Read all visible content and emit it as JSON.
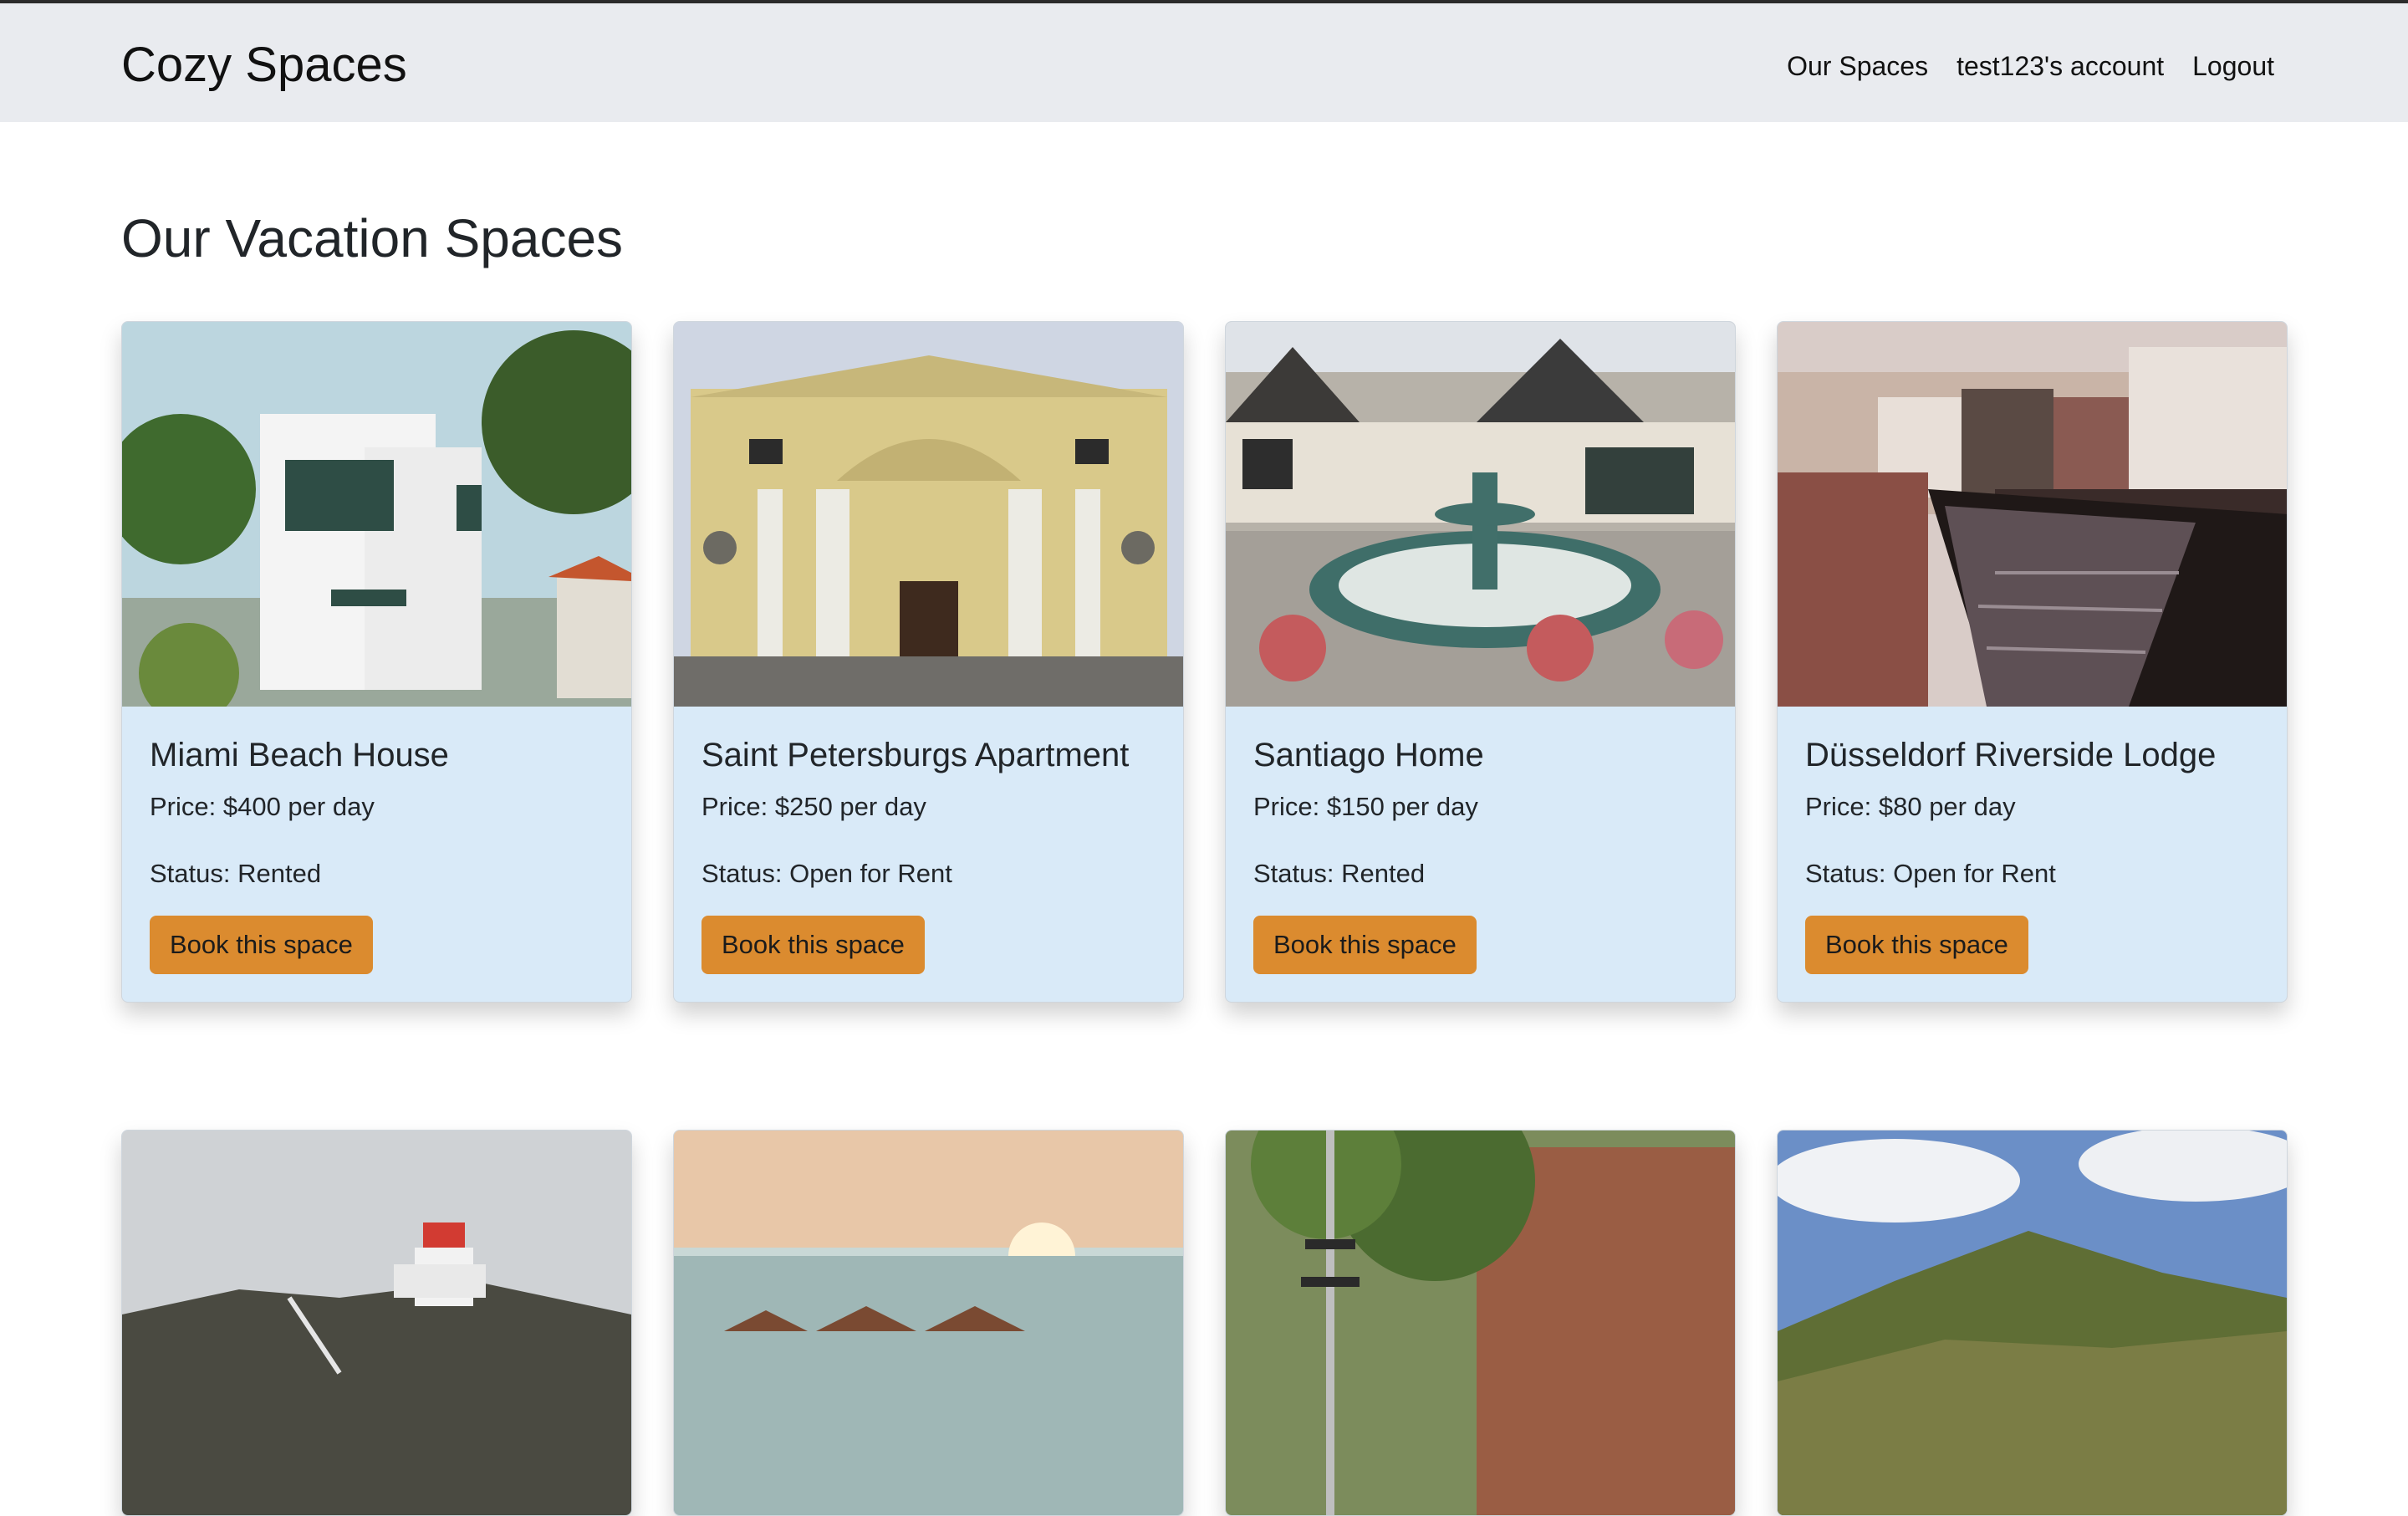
{
  "navbar": {
    "brand": "Cozy Spaces",
    "links": [
      "Our Spaces",
      "test123's account",
      "Logout"
    ]
  },
  "page": {
    "title": "Our Vacation Spaces"
  },
  "spaces": [
    {
      "name": "Miami Beach House",
      "price": "Price: $400 per day",
      "status": "Status: Rented",
      "button": "Book this space",
      "image": "white-modern-house-photo"
    },
    {
      "name": "Saint Petersburgs Apartment",
      "price": "Price: $250 per day",
      "status": "Status: Open for Rent",
      "button": "Book this space",
      "image": "yellow-cathedral-photo"
    },
    {
      "name": "Santiago Home",
      "price": "Price: $150 per day",
      "status": "Status: Rented",
      "button": "Book this space",
      "image": "fountain-courtyard-photo"
    },
    {
      "name": "Düsseldorf Riverside Lodge",
      "price": "Price: $80 per day",
      "status": "Status: Open for Rent",
      "button": "Book this space",
      "image": "canal-town-photo"
    },
    {
      "image": "lighthouse-photo"
    },
    {
      "image": "overwater-villas-sunset-photo"
    },
    {
      "image": "city-street-trees-photo"
    },
    {
      "image": "forested-hill-photo"
    }
  ],
  "colors": {
    "navbar_bg": "#e9ebef",
    "card_bg": "#d9eaf8",
    "button_bg": "#db8b2f"
  }
}
